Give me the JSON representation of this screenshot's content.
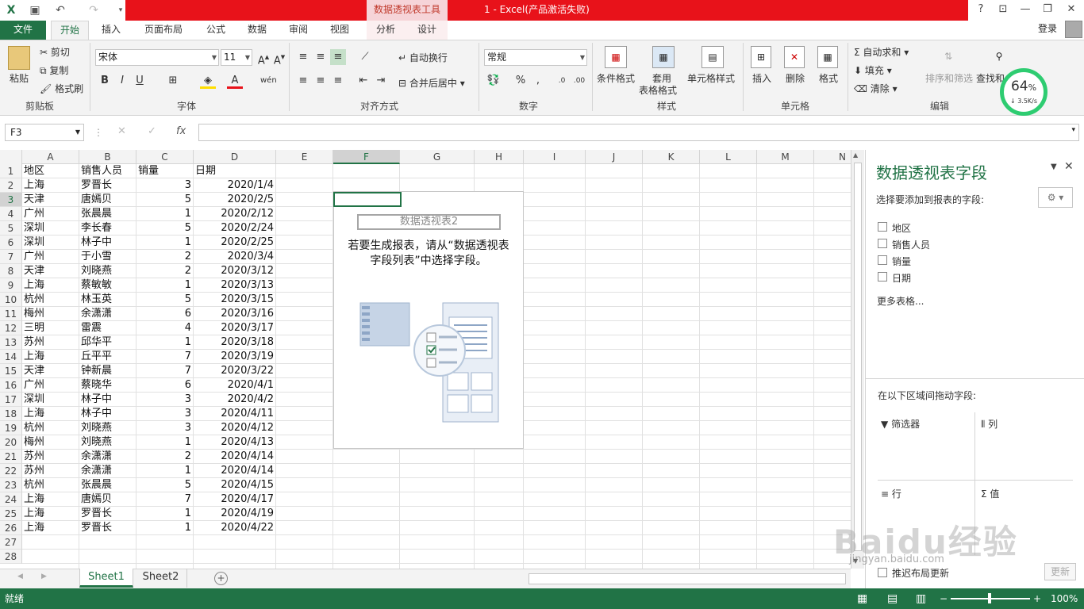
{
  "window": {
    "title": "1 -  Excel(产品激活失败)",
    "context_group": "数据透视表工具"
  },
  "tabs": [
    "文件",
    "开始",
    "插入",
    "页面布局",
    "公式",
    "数据",
    "审阅",
    "视图",
    "分析",
    "设计"
  ],
  "login": "登录",
  "ribbon": {
    "clipboard": {
      "paste": "粘贴",
      "cut": "剪切",
      "copy": "复制",
      "painter": "格式刷",
      "label": "剪贴板"
    },
    "font": {
      "name": "宋体",
      "size": "11",
      "label": "字体"
    },
    "align": {
      "wrap": "自动换行",
      "merge": "合并后居中",
      "label": "对齐方式"
    },
    "number": {
      "format": "常规",
      "label": "数字"
    },
    "styles": {
      "cond": "条件格式",
      "table": "套用",
      "table2": "表格格式",
      "cell": "单元格样式",
      "label": "样式"
    },
    "cells": {
      "insert": "插入",
      "delete": "删除",
      "format": "格式",
      "label": "单元格"
    },
    "edit": {
      "autosum": "自动求和",
      "fill": "填充",
      "clear": "清除",
      "sort": "排序和筛选",
      "find": "查找和",
      "label": "编辑"
    }
  },
  "speed": {
    "percent": "64",
    "unit": "%",
    "rate": "3.5K/s"
  },
  "namebox": "F3",
  "fx": "fx",
  "columns": [
    "A",
    "B",
    "C",
    "D",
    "E",
    "F",
    "G",
    "H",
    "I",
    "J",
    "K",
    "L",
    "M",
    "N"
  ],
  "rows": [
    [
      "地区",
      "销售人员",
      "销量",
      "日期"
    ],
    [
      "上海",
      "罗晋长",
      "3",
      "2020/1/4"
    ],
    [
      "天津",
      "唐嫣贝",
      "5",
      "2020/2/5"
    ],
    [
      "广州",
      "张晨晨",
      "1",
      "2020/2/12"
    ],
    [
      "深圳",
      "李长春",
      "5",
      "2020/2/24"
    ],
    [
      "深圳",
      "林子中",
      "1",
      "2020/2/25"
    ],
    [
      "广州",
      "于小雪",
      "2",
      "2020/3/4"
    ],
    [
      "天津",
      "刘晓燕",
      "2",
      "2020/3/12"
    ],
    [
      "上海",
      "蔡敏敏",
      "1",
      "2020/3/13"
    ],
    [
      "杭州",
      "林玉英",
      "5",
      "2020/3/15"
    ],
    [
      "梅州",
      "余潇潇",
      "6",
      "2020/3/16"
    ],
    [
      "三明",
      "雷震",
      "4",
      "2020/3/17"
    ],
    [
      "苏州",
      "邱华平",
      "1",
      "2020/3/18"
    ],
    [
      "上海",
      "丘平平",
      "7",
      "2020/3/19"
    ],
    [
      "天津",
      "钟新晨",
      "7",
      "2020/3/22"
    ],
    [
      "广州",
      "蔡晓华",
      "6",
      "2020/4/1"
    ],
    [
      "深圳",
      "林子中",
      "3",
      "2020/4/2"
    ],
    [
      "上海",
      "林子中",
      "3",
      "2020/4/11"
    ],
    [
      "杭州",
      "刘晓燕",
      "3",
      "2020/4/12"
    ],
    [
      "梅州",
      "刘晓燕",
      "1",
      "2020/4/13"
    ],
    [
      "苏州",
      "余潇潇",
      "2",
      "2020/4/14"
    ],
    [
      "苏州",
      "余潇潇",
      "1",
      "2020/4/14"
    ],
    [
      "杭州",
      "张晨晨",
      "5",
      "2020/4/15"
    ],
    [
      "上海",
      "唐嫣贝",
      "7",
      "2020/4/17"
    ],
    [
      "上海",
      "罗晋长",
      "1",
      "2020/4/19"
    ],
    [
      "上海",
      "罗晋长",
      "1",
      "2020/4/22"
    ]
  ],
  "row_numbers": [
    "1",
    "2",
    "3",
    "4",
    "5",
    "6",
    "7",
    "8",
    "9",
    "10",
    "11",
    "12",
    "13",
    "14",
    "15",
    "16",
    "17",
    "18",
    "19",
    "20",
    "21",
    "22",
    "23",
    "24",
    "25",
    "26",
    "27",
    "28"
  ],
  "pivot": {
    "name": "数据透视表2",
    "msg1": "若要生成报表，请从“数据透视表",
    "msg2": "字段列表”中选择字段。"
  },
  "pane": {
    "title": "数据透视表字段",
    "subtitle": "选择要添加到报表的字段:",
    "fields": [
      "地区",
      "销售人员",
      "销量",
      "日期"
    ],
    "more": "更多表格...",
    "drag": "在以下区域间拖动字段:",
    "filter": "筛选器",
    "col": "列",
    "row": "行",
    "val": "值",
    "defer": "推迟布局更新",
    "update": "更新"
  },
  "sheets": [
    "Sheet1",
    "Sheet2"
  ],
  "status": {
    "ready": "就绪",
    "zoom": "100%"
  },
  "watermark": {
    "big": "Baidu经验",
    "small": "jingyan.baidu.com"
  }
}
